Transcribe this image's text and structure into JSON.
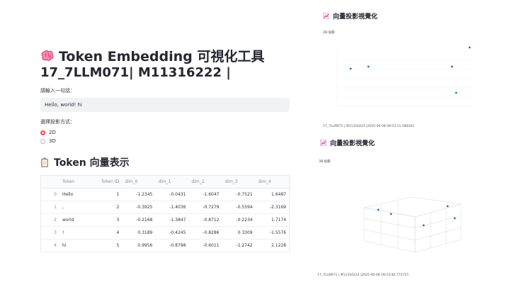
{
  "main": {
    "title": "Token Embedding 可視化工具",
    "title_icon": "brain-icon",
    "subtitle": "17_7LLM071| M11316222 |",
    "input_label": "請輸入一句話：",
    "input_value": "Hello, world! hi",
    "radio_label": "選擇投影方式：",
    "radio_options": [
      "2D",
      "3D"
    ],
    "radio_selected": "2D",
    "table_heading": "Token 向量表示",
    "table_icon": "clipboard-icon",
    "table": {
      "columns": [
        "",
        "Token",
        "Token ID",
        "dim_0",
        "dim_1",
        "dim_2",
        "dim_3",
        "dim_4"
      ],
      "rows": [
        [
          "0",
          "Hello",
          "1",
          "-1.2345",
          "-0.0431",
          "-1.6047",
          "-0.7521",
          "1.6487"
        ],
        [
          "1",
          ",",
          "2",
          "-0.3925",
          "-1.4036",
          "-0.7279",
          "-0.5594",
          "-2.3169"
        ],
        [
          "2",
          "world",
          "3",
          "-0.2168",
          "-1.3847",
          "-0.8712",
          "-0.2234",
          "1.7174"
        ],
        [
          "3",
          "!",
          "4",
          "0.3189",
          "-0.4245",
          "-0.8286",
          "0.3309",
          "-1.5576"
        ],
        [
          "4",
          "hi",
          "5",
          "0.9956",
          "-0.8798",
          "-0.6011",
          "-1.2742",
          "2.1228"
        ]
      ]
    }
  },
  "right": {
    "heading_2d": "向量投影視覺化",
    "plot_2d_title": "2D 投影",
    "caption_2d": "17_7LLM071 | M11316222 |2025-06-06 09:53:11.286442",
    "heading_3d": "向量投影視覺化",
    "plot_3d_title": "3D 投影",
    "caption_3d": "17_7LLM071 | M11316222 |2025-06-06 09:53:00.772715",
    "heading_icon": "chart-icon"
  },
  "colors": {
    "accent": "#ff4b4b",
    "point": "#1f77b4",
    "input_bg": "#f0f2f6"
  }
}
